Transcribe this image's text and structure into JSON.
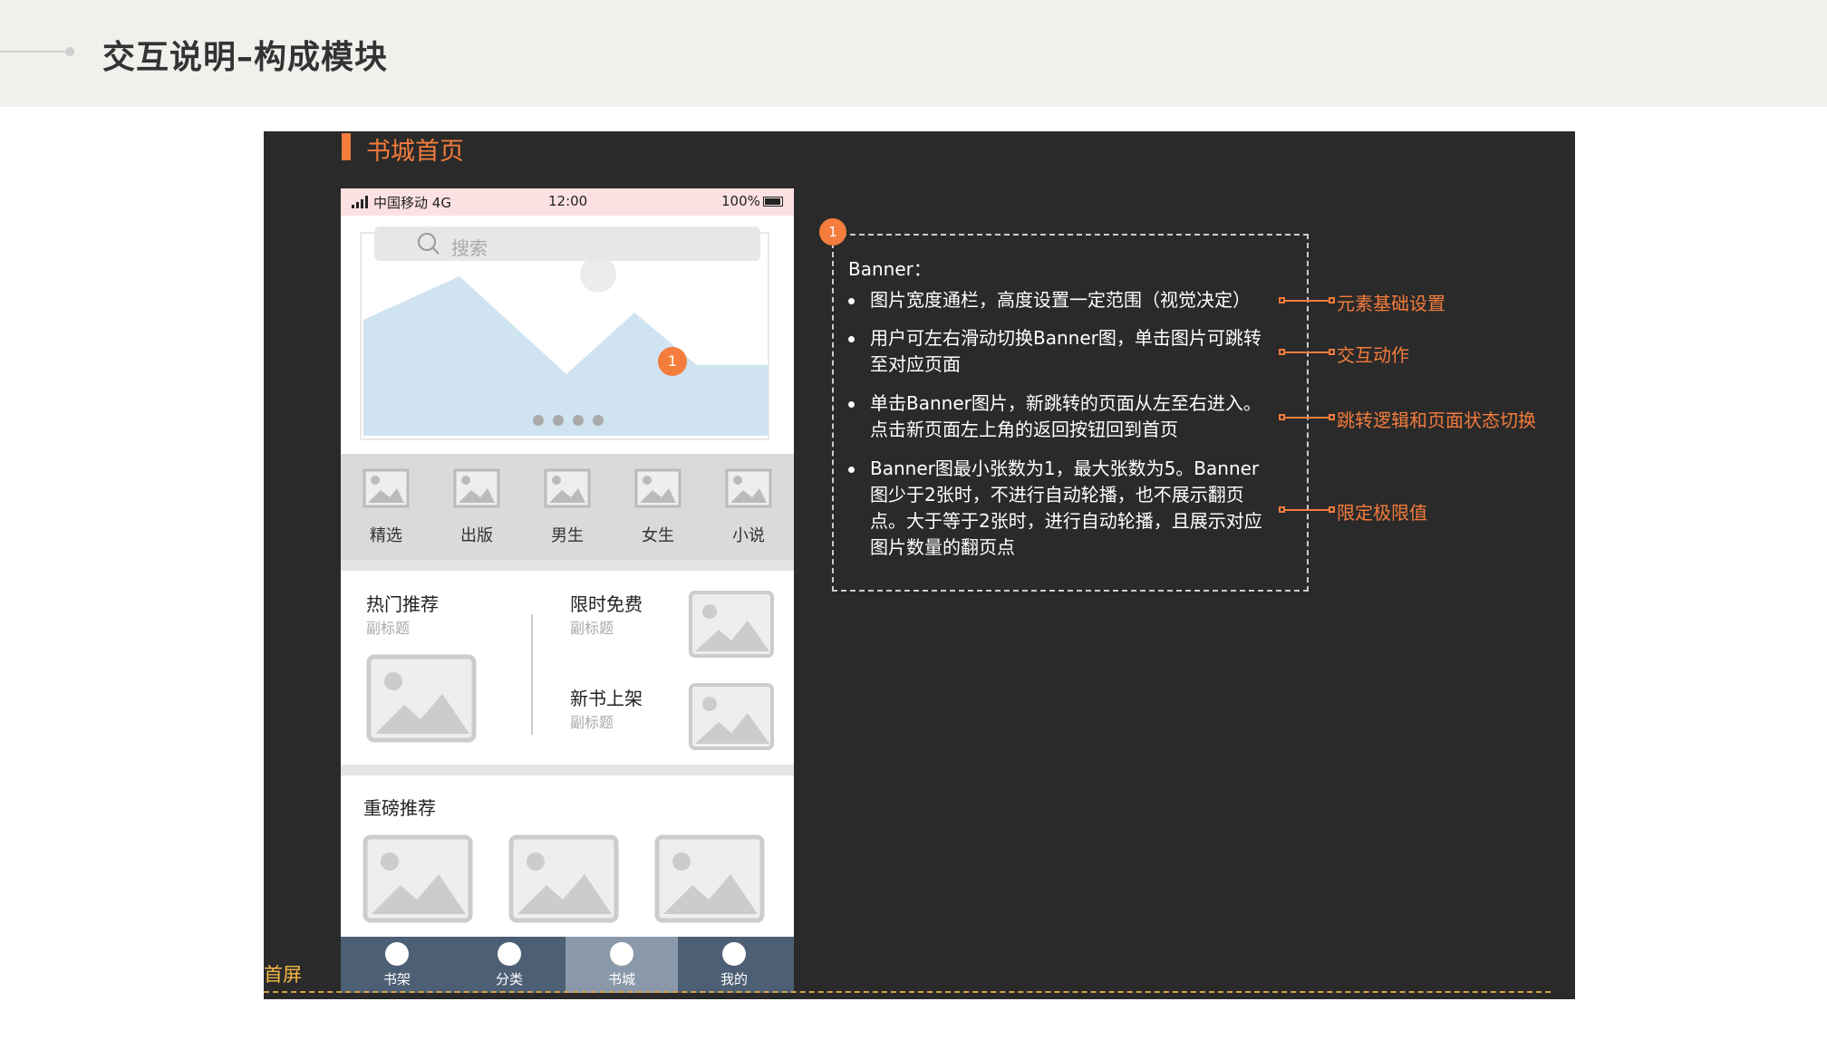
{
  "header": {
    "title": "交互说明–构成模块"
  },
  "section": {
    "title": "书城首页"
  },
  "phone": {
    "status": {
      "carrier": "中国移动",
      "network": "4G",
      "time": "12:00",
      "battery": "100%"
    },
    "search": {
      "placeholder": "搜索"
    },
    "banner": {
      "badge": "1",
      "page_dots": 4
    },
    "quick_items": [
      {
        "label": "精选"
      },
      {
        "label": "出版"
      },
      {
        "label": "男生"
      },
      {
        "label": "女生"
      },
      {
        "label": "小说"
      }
    ],
    "hot": {
      "title": "热门推荐",
      "subtitle": "副标题"
    },
    "free": {
      "title": "限时免费",
      "subtitle": "副标题"
    },
    "newbook": {
      "title": "新书上架",
      "subtitle": "副标题"
    },
    "featured": {
      "title": "重磅推荐"
    },
    "tabs": [
      {
        "label": "书架",
        "active": false
      },
      {
        "label": "分类",
        "active": false
      },
      {
        "label": "书城",
        "active": true
      },
      {
        "label": "我的",
        "active": false
      }
    ]
  },
  "fold": {
    "label": "首屏"
  },
  "note": {
    "badge": "1",
    "heading": "Banner：",
    "bullets": [
      {
        "text": "图片宽度通栏，高度设置一定范围（视觉决定）",
        "tag": "元素基础设置"
      },
      {
        "text": "用户可左右滑动切换Banner图，单击图片可跳转至对应页面",
        "tag": "交互动作"
      },
      {
        "text": "单击Banner图片，新跳转的页面从左至右进入。点击新页面左上角的返回按钮回到首页",
        "tag": "跳转逻辑和页面状态切换"
      },
      {
        "text": "Banner图最小张数为1，最大张数为5。Banner图少于2张时，不进行自动轮播，也不展示翻页点。大于等于2张时，进行自动轮播，且展示对应图片数量的翻页点",
        "tag": "限定极限值"
      }
    ]
  },
  "colors": {
    "accent": "#f47c3c",
    "canvas": "#2a2a2a",
    "fold": "#f4b844",
    "tabbar": "#4d5f74",
    "banner_fill": "#cfe3f1"
  }
}
